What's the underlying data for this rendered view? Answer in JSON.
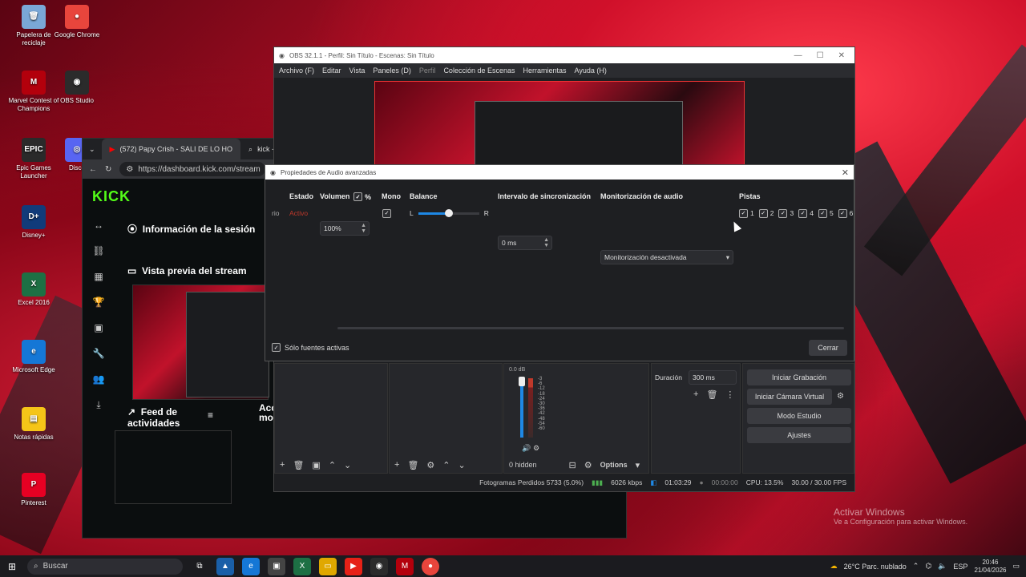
{
  "desktop": {
    "icons": [
      {
        "label": "Papelera de reciclaje",
        "icon": "recycle-bin-icon",
        "color": "#7aa7d6",
        "glyph": "🗑"
      },
      {
        "label": "Google Chrome",
        "icon": "chrome-icon",
        "color": "#e8453c",
        "glyph": "●"
      },
      {
        "label": "Marvel Contest of Champions",
        "icon": "marvel-icon",
        "color": "#b3000c",
        "glyph": "M"
      },
      {
        "label": "OBS Studio",
        "icon": "obs-icon",
        "color": "#2b2b2b",
        "glyph": "◉"
      },
      {
        "label": "Epic Games Launcher",
        "icon": "epic-icon",
        "color": "#2a2a2a",
        "glyph": "EPIC"
      },
      {
        "label": "Disco",
        "icon": "discord-icon",
        "color": "#5865f2",
        "glyph": "◎"
      },
      {
        "label": "Disney+",
        "icon": "disney-icon",
        "color": "#113b7a",
        "glyph": "D+"
      },
      {
        "label": "Excel 2016",
        "icon": "excel-icon",
        "color": "#1d7044",
        "glyph": "X"
      },
      {
        "label": "Microsoft Edge",
        "icon": "edge-icon",
        "color": "#1577d6",
        "glyph": "e"
      },
      {
        "label": "Notas rápidas",
        "icon": "sticky-notes-icon",
        "color": "#f5c518",
        "glyph": "▤"
      },
      {
        "label": "Pinterest",
        "icon": "pinterest-icon",
        "color": "#e60023",
        "glyph": "P"
      }
    ]
  },
  "browser": {
    "tab1": "(572) Papy Crish - SALI DE LO HO",
    "tab2": "kick - Bús",
    "url": "https://dashboard.kick.com/stream",
    "logo": "KICK",
    "session_info": "Información de la sesión",
    "stream_preview": "Vista previa del stream",
    "activity_feed": "Feed de actividades",
    "acc_fragment": "Acc",
    "mo_fragment": "mo"
  },
  "obs": {
    "title": "OBS 32.1.1 - Perfil: Sin Título - Escenas: Sin Título",
    "menu": [
      "Archivo (F)",
      "Editar",
      "Vista",
      "Paneles (D)",
      "Perfil",
      "Colección de Escenas",
      "Herramientas",
      "Ayuda (H)"
    ],
    "mixer_db": "0.0 dB",
    "meter_ticks": [
      "-3",
      "-6",
      "-12",
      "-18",
      "-24",
      "-30",
      "-36",
      "-42",
      "-48",
      "-54",
      "-60"
    ],
    "hidden_label": "0 hidden",
    "options_label": "Options",
    "duration_label": "Duración",
    "duration_value": "300 ms",
    "controls": [
      "Iniciar Grabación",
      "Iniciar Cámara Virtual",
      "Modo Estudio",
      "Ajustes"
    ],
    "status": {
      "dropped": "Fotogramas Perdidos 5733 (5.0%)",
      "bitrate": "6026 kbps",
      "stream_time": "01:03:29",
      "rec_time": "00:00:00",
      "cpu": "CPU: 13.5%",
      "fps": "30.00 / 30.00 FPS"
    }
  },
  "dialog": {
    "title": "Propiedades de Audio avanzadas",
    "headers": {
      "estado": "Estado",
      "volumen": "Volumen",
      "percent": "%",
      "mono": "Mono",
      "balance": "Balance",
      "sync": "Intervalo de sincronización",
      "monitor": "Monitorización de audio",
      "pistas": "Pistas"
    },
    "row": {
      "name_fragment": "rio",
      "estado": "Activo",
      "volume": "100%",
      "balance_l": "L",
      "balance_r": "R",
      "balance_value": 0.5,
      "sync": "0 ms",
      "monitor": "Monitorización desactivada",
      "tracks": [
        "1",
        "2",
        "3",
        "4",
        "5",
        "6"
      ]
    },
    "only_active": "Sólo fuentes activas",
    "close": "Cerrar"
  },
  "taskbar": {
    "search": "Buscar",
    "weather": "26°C  Parc. nublado",
    "lang": "ESP",
    "time": "20:46",
    "date": "21/04/2026"
  },
  "watermark": {
    "title": "Activar Windows",
    "sub": "Ve a Configuración para activar Windows."
  },
  "colors": {
    "kick_green": "#53fc18",
    "accent_blue": "#1e88e5",
    "status_red": "#c0392b"
  }
}
